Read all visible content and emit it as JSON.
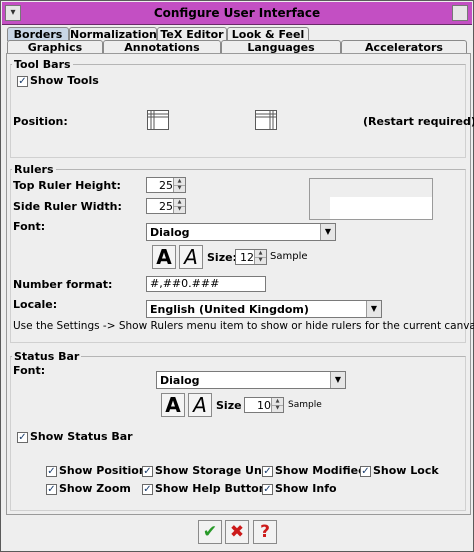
{
  "window": {
    "title": "Configure User Interface"
  },
  "tabs_row1": [
    "Borders",
    "Normalization",
    "TeX Editor",
    "Look & Feel"
  ],
  "tabs_row2": [
    "Graphics",
    "Annotations",
    "Languages",
    "Accelerators"
  ],
  "toolbars": {
    "group_title": "Tool Bars",
    "show_tools": "Show Tools",
    "position_label": "Position:",
    "restart_note": "(Restart required)"
  },
  "rulers": {
    "group_title": "Rulers",
    "top_height_label": "Top Ruler Height:",
    "top_height_value": "25",
    "side_width_label": "Side Ruler Width:",
    "side_width_value": "25",
    "font_label": "Font:",
    "font_value": "Dialog",
    "size_label": "Size:",
    "size_value": "12",
    "sample": "Sample",
    "number_format_label": "Number format:",
    "number_format_value": "#,##0.###",
    "locale_label": "Locale:",
    "locale_value": "English (United Kingdom)",
    "hint": "Use the Settings -> Show Rulers menu item to show or hide rulers for the current canvas."
  },
  "statusbar": {
    "group_title": "Status Bar",
    "font_label": "Font:",
    "font_value": "Dialog",
    "size_label": "Size",
    "size_value": "10",
    "sample": "Sample",
    "show_status_bar": "Show Status Bar",
    "options": [
      "Show Position",
      "Show Storage Unit",
      "Show Modified",
      "Show Lock",
      "Show Zoom",
      "Show Help Button",
      "Show Info"
    ]
  },
  "font_buttons": {
    "bold": "A",
    "italic": "A"
  },
  "buttons": {
    "ok": "✔",
    "cancel": "✖",
    "help": "?"
  },
  "colors": {
    "title_bar": "#c34fc3",
    "ok": "#2a9a2a",
    "cancel": "#cc1a1a",
    "help": "#cc1a1a"
  }
}
